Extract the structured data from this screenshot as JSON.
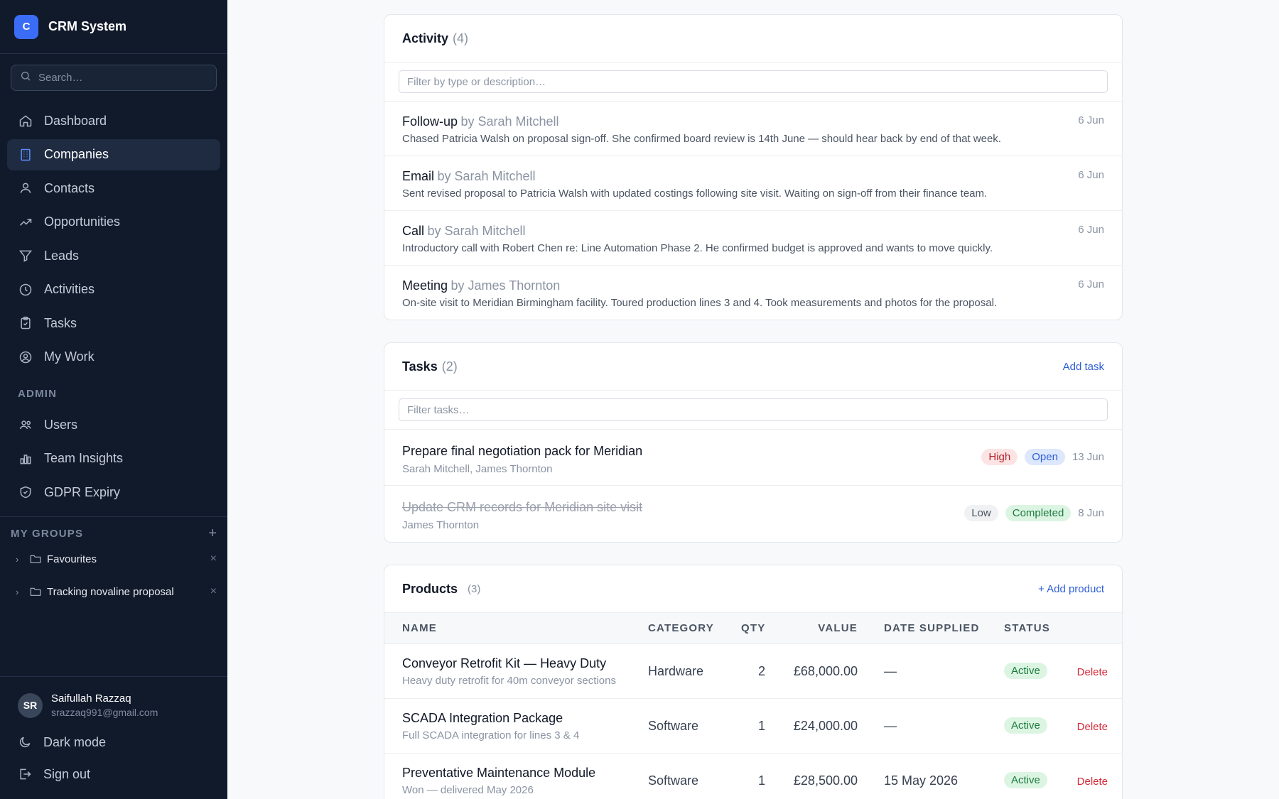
{
  "app": {
    "logo_letter": "C",
    "name": "CRM System"
  },
  "search": {
    "placeholder": "Search…"
  },
  "nav": {
    "items": [
      {
        "label": "Dashboard",
        "icon": "home-icon"
      },
      {
        "label": "Companies",
        "icon": "building-icon",
        "active": true
      },
      {
        "label": "Contacts",
        "icon": "users-icon"
      },
      {
        "label": "Opportunities",
        "icon": "trending-up-icon"
      },
      {
        "label": "Leads",
        "icon": "filter-icon"
      },
      {
        "label": "Activities",
        "icon": "clock-icon"
      },
      {
        "label": "Tasks",
        "icon": "clipboard-icon"
      },
      {
        "label": "My Work",
        "icon": "user-circle-icon"
      }
    ],
    "admin_label": "ADMIN",
    "admin_items": [
      {
        "label": "Users",
        "icon": "users-group-icon"
      },
      {
        "label": "Team Insights",
        "icon": "bar-chart-icon"
      },
      {
        "label": "GDPR Expiry",
        "icon": "shield-icon"
      }
    ]
  },
  "groups": {
    "label": "MY GROUPS",
    "items": [
      {
        "label": "Favourites"
      },
      {
        "label": "Tracking novaline proposal"
      }
    ]
  },
  "user": {
    "initials": "SR",
    "name": "Saifullah Razzaq",
    "email": "srazzaq991@gmail.com"
  },
  "bottom": {
    "dark_mode": "Dark mode",
    "sign_out": "Sign out"
  },
  "activity": {
    "title": "Activity",
    "count": "(4)",
    "filter_placeholder": "Filter by type or description…",
    "items": [
      {
        "type": "Follow-up",
        "by": "by Sarah Mitchell",
        "desc": "Chased Patricia Walsh on proposal sign-off. She confirmed board review is 14th June — should hear back by end of that week.",
        "date": "6 Jun"
      },
      {
        "type": "Email",
        "by": "by Sarah Mitchell",
        "desc": "Sent revised proposal to Patricia Walsh with updated costings following site visit. Waiting on sign-off from their finance team.",
        "date": "6 Jun"
      },
      {
        "type": "Call",
        "by": "by Sarah Mitchell",
        "desc": "Introductory call with Robert Chen re: Line Automation Phase 2. He confirmed budget is approved and wants to move quickly.",
        "date": "6 Jun"
      },
      {
        "type": "Meeting",
        "by": "by James Thornton",
        "desc": "On-site visit to Meridian Birmingham facility. Toured production lines 3 and 4. Took measurements and photos for the proposal.",
        "date": "6 Jun"
      }
    ]
  },
  "tasks": {
    "title": "Tasks",
    "count": "(2)",
    "add_label": "Add task",
    "filter_placeholder": "Filter tasks…",
    "items": [
      {
        "title": "Prepare final negotiation pack for Meridian",
        "people": "Sarah Mitchell, James Thornton",
        "priority": "High",
        "status": "Open",
        "date": "13 Jun",
        "done": false
      },
      {
        "title": "Update CRM records for Meridian site visit",
        "people": "James Thornton",
        "priority": "Low",
        "status": "Completed",
        "date": "8 Jun",
        "done": true
      }
    ]
  },
  "products": {
    "title": "Products",
    "count": "(3)",
    "add_label": "+ Add product",
    "columns": {
      "name": "NAME",
      "category": "CATEGORY",
      "qty": "QTY",
      "value": "VALUE",
      "date": "DATE SUPPLIED",
      "status": "STATUS"
    },
    "rows": [
      {
        "name": "Conveyor Retrofit Kit — Heavy Duty",
        "desc": "Heavy duty retrofit for 40m conveyor sections",
        "category": "Hardware",
        "qty": "2",
        "value": "£68,000.00",
        "date": "—",
        "status": "Active",
        "action": "Delete"
      },
      {
        "name": "SCADA Integration Package",
        "desc": "Full SCADA integration for lines 3 & 4",
        "category": "Software",
        "qty": "1",
        "value": "£24,000.00",
        "date": "—",
        "status": "Active",
        "action": "Delete"
      },
      {
        "name": "Preventative Maintenance Module",
        "desc": "Won — delivered May 2026",
        "category": "Software",
        "qty": "1",
        "value": "£28,500.00",
        "date": "15 May 2026",
        "status": "Active",
        "action": "Delete"
      }
    ]
  },
  "colors": {
    "sidebar_bg": "#111a2b",
    "accent": "#3b6cf6",
    "link": "#2f5fd6",
    "danger": "#d42a3a",
    "success": "#1d7a3e"
  }
}
